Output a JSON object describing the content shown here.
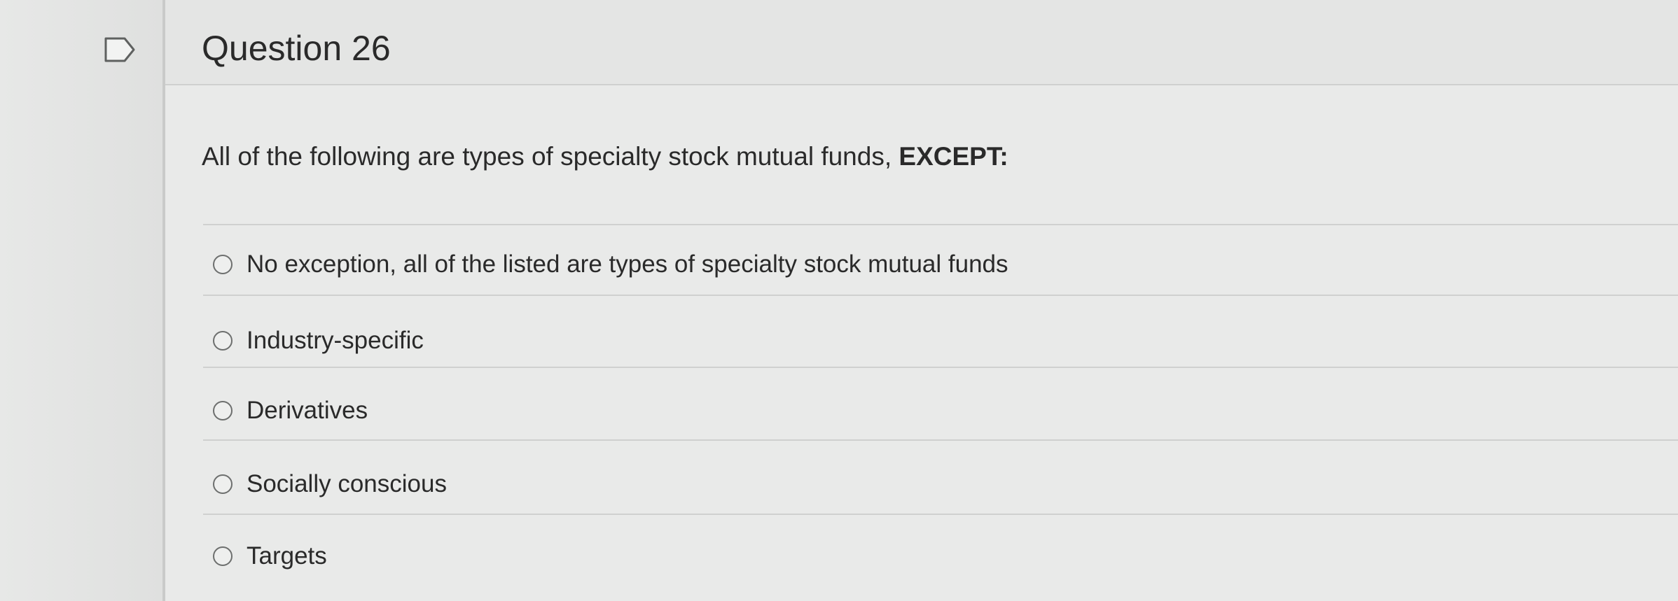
{
  "question": {
    "flag_icon": "flag-outline-icon",
    "title": "Question 26",
    "prompt": "All of the following are types of specialty stock mutual funds, ",
    "prompt_emphasis": "EXCEPT:",
    "answers": [
      {
        "label": "No exception, all of the listed are types of specialty stock mutual funds",
        "selected": false
      },
      {
        "label": "Industry-specific",
        "selected": false
      },
      {
        "label": "Derivatives",
        "selected": false
      },
      {
        "label": "Socially conscious",
        "selected": false
      },
      {
        "label": "Targets",
        "selected": false
      }
    ]
  }
}
